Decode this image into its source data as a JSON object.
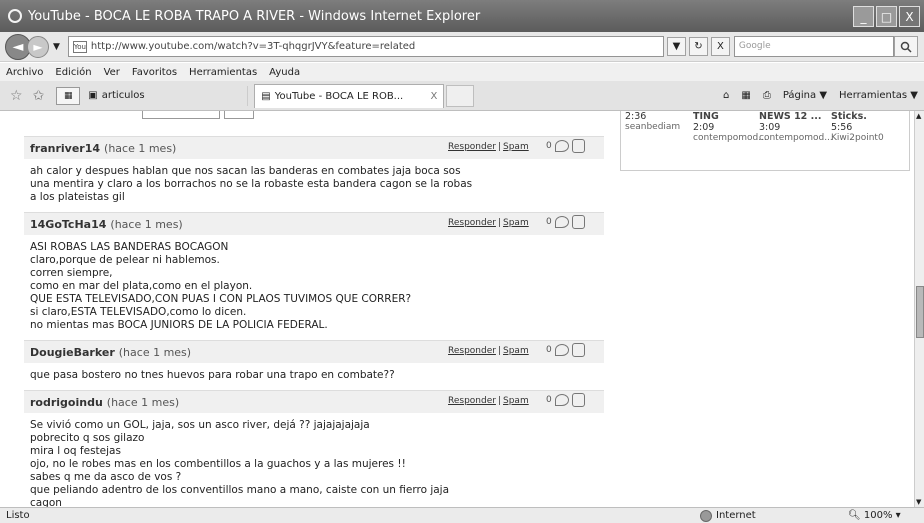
{
  "window": {
    "title": "YouTube - BOCA LE ROBA TRAPO A RIVER - Windows Internet Explorer",
    "min": "_",
    "max": "□",
    "close": "X"
  },
  "nav": {
    "back": "◄",
    "forward": "►",
    "dropdown": "▼",
    "url": "http://www.youtube.com/watch?v=3T-qhqgrJVY&feature=related",
    "favicon": "You",
    "refresh": "↻",
    "stop": "X",
    "search_placeholder": "Google",
    "search_icon": "search-icon"
  },
  "menu": [
    "Archivo",
    "Edición",
    "Ver",
    "Favoritos",
    "Herramientas",
    "Ayuda"
  ],
  "tabs": {
    "fav_label": "articulos",
    "active_label": "YouTube - BOCA LE ROB...",
    "active_close": "X",
    "commands": [
      "Página ▼",
      "Herramientas ▼"
    ]
  },
  "status": {
    "text": "Listo",
    "zone": "Internet",
    "zoom": "100%"
  },
  "sidebar": {
    "columns": [
      {
        "header": "",
        "time": "2:36",
        "user": "seanbediam"
      },
      {
        "header": "TING",
        "time": "2:09",
        "user": "contempomod..."
      },
      {
        "header": "NEWS 12 ...",
        "time": "3:09",
        "user": "contempomod..."
      },
      {
        "header": "Sticks.",
        "time": "5:56",
        "user": "Kiwi2point0"
      }
    ]
  },
  "comments": [
    {
      "author": "franriver14",
      "age": "(hace 1 mes)",
      "reply": "Responder",
      "spam": "Spam",
      "score": "0",
      "lines": [
        "ah calor y despues hablan que nos sacan las banderas en combates jaja boca sos",
        "una mentira y claro a los borrachos no se la robaste esta bandera cagon se la robas",
        "a los plateistas gil"
      ]
    },
    {
      "author": "14GoTcHa14",
      "age": "(hace 1 mes)",
      "reply": "Responder",
      "spam": "Spam",
      "score": "0",
      "lines": [
        "ASI ROBAS LAS BANDERAS BOCAGON",
        "claro,porque de pelear ni hablemos.",
        "corren siempre,",
        "como en mar del plata,como en el playon.",
        "QUE ESTA TELEVISADO,CON PUAS I CON PLAOS TUVIMOS QUE CORRER?",
        "si claro,ESTA TELEVISADO,como lo dicen.",
        "no mientas mas BOCA JUNIORS DE LA POLICIA FEDERAL."
      ]
    },
    {
      "author": "DougieBarker",
      "age": "(hace 1 mes)",
      "reply": "Responder",
      "spam": "Spam",
      "score": "0",
      "lines": [
        "que pasa bostero no tnes huevos para robar una trapo en combate??"
      ]
    },
    {
      "author": "rodrigoindu",
      "age": "(hace 1 mes)",
      "reply": "Responder",
      "spam": "Spam",
      "score": "0",
      "lines": [
        "Se vivió como un GOL, jaja, sos un asco river, dejá ?? jajajajajaja",
        "pobrecito q sos gilazo",
        "mira l oq festejas",
        "ojo, no le robes mas en los combentillos a la guachos y a las mujeres !!",
        "sabes q me da asco de vos ?",
        "que peliando adentro de los conventillos mano a mano, caiste con un fierro jaja",
        "cagon"
      ]
    }
  ]
}
